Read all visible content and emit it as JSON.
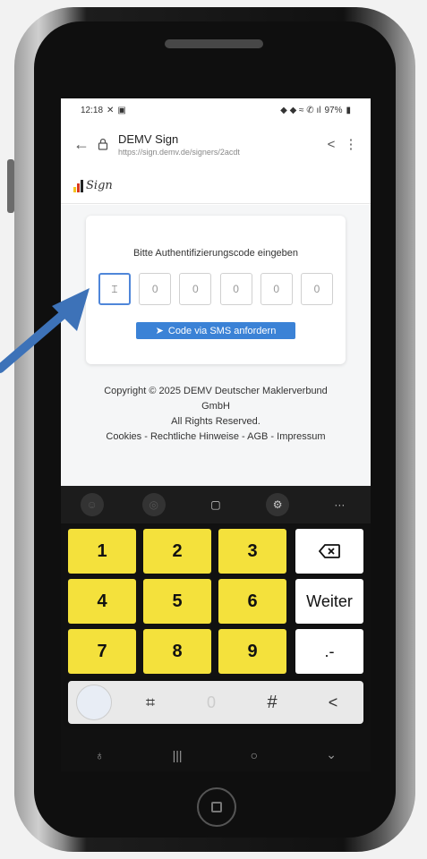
{
  "status_bar": {
    "time": "12:18",
    "battery": "97%"
  },
  "browser": {
    "site_title": "DEMV Sign",
    "url": "https://sign.demv.de/signers/2acdt"
  },
  "logo_text": "Sign",
  "auth_card": {
    "title": "Bitte Authentifizierungscode eingeben",
    "code_digits": [
      "",
      "0",
      "0",
      "0",
      "0",
      "0"
    ],
    "sms_button_label": "Code via SMS anfordern"
  },
  "footer": {
    "copyright_line1": "Copyright © 2025 DEMV Deutscher Maklerverbund",
    "copyright_line2": "GmbH",
    "rights": "All Rights Reserved.",
    "links": "Cookies - Rechtliche Hinweise - AGB - Impressum"
  },
  "keyboard": {
    "keys": [
      "1",
      "2",
      "3",
      "4",
      "5",
      "6",
      "7",
      "8",
      "9"
    ],
    "next_label": "Weiter",
    "punct_label": ".-",
    "hash_label": "#",
    "zero_label": "0",
    "digit_key_color": "#f4e13c",
    "toolbar_icons": [
      "emoji-icon",
      "sticker-icon",
      "clipboard-icon",
      "settings-icon",
      "more-icon"
    ]
  },
  "colors": {
    "accent": "#3b82d6",
    "arrow": "#3d72b8",
    "active_input": "#4f86d9"
  }
}
